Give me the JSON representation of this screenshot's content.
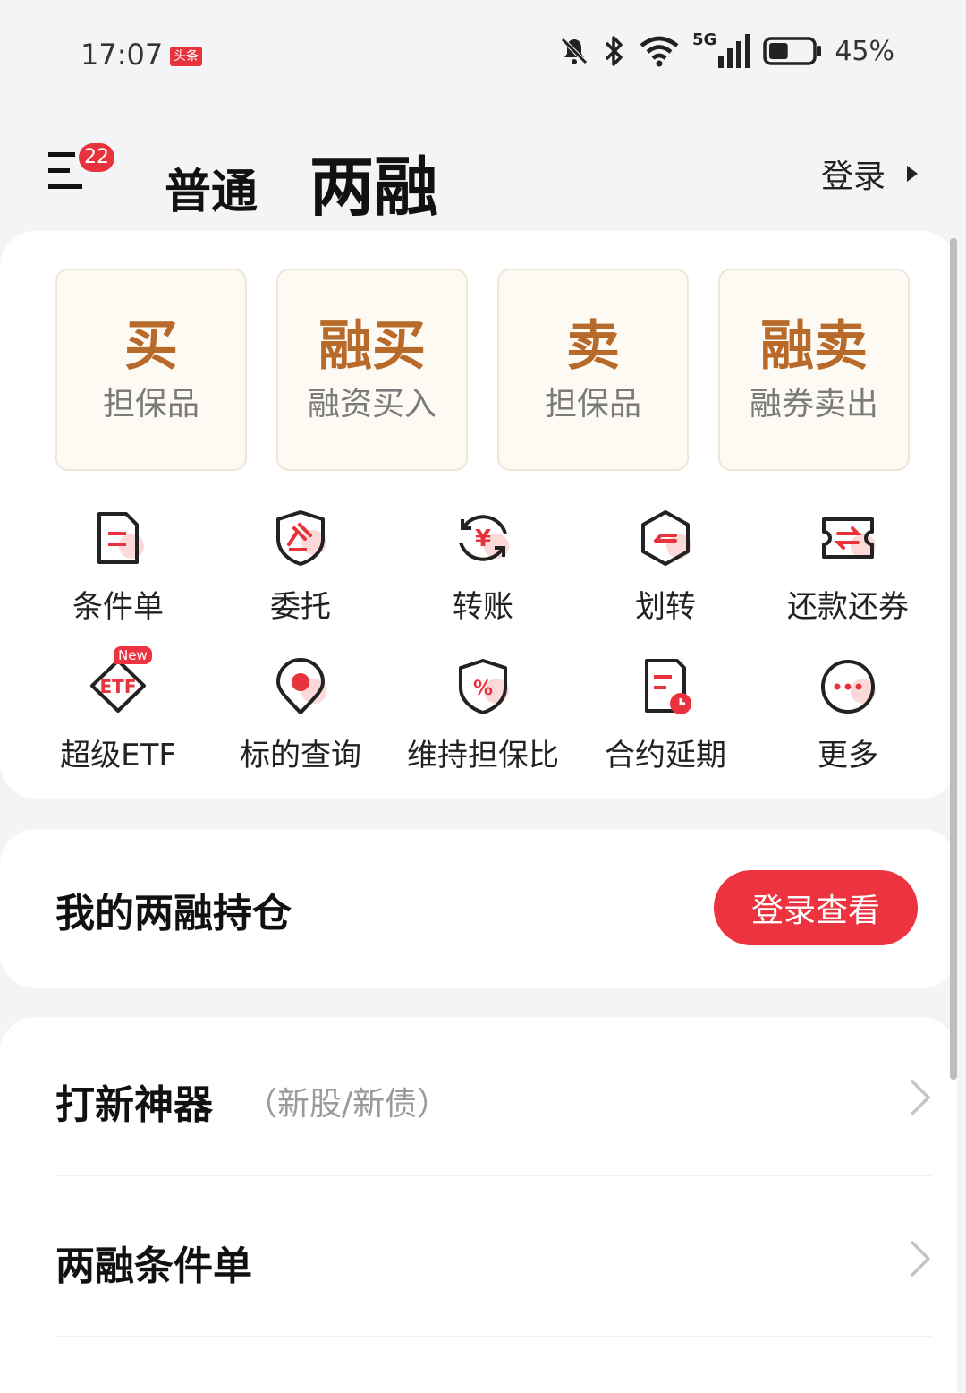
{
  "status": {
    "time": "17:07",
    "app_badge": "头条",
    "network": "5G",
    "battery": "45%",
    "battery_level": 0.45,
    "icons": [
      "mute-icon",
      "bluetooth-icon",
      "wifi-icon",
      "signal-icon",
      "battery-icon"
    ]
  },
  "header": {
    "menu_badge": "22",
    "tab_normal": "普通",
    "tab_margin": "两融",
    "login": "登录"
  },
  "trade_tiles": [
    {
      "main": "买",
      "sub": "担保品"
    },
    {
      "main": "融买",
      "sub": "融资买入"
    },
    {
      "main": "卖",
      "sub": "担保品"
    },
    {
      "main": "融卖",
      "sub": "融券卖出"
    }
  ],
  "grid": [
    {
      "label": "条件单",
      "icon": "condition-order-icon"
    },
    {
      "label": "委托",
      "icon": "entrust-icon"
    },
    {
      "label": "转账",
      "icon": "transfer-yuan-icon"
    },
    {
      "label": "划转",
      "icon": "transfer-icon"
    },
    {
      "label": "还款还券",
      "icon": "repay-icon"
    },
    {
      "label": "超级ETF",
      "icon": "etf-icon",
      "badge": "New",
      "icon_text": "ETF"
    },
    {
      "label": "标的查询",
      "icon": "location-icon"
    },
    {
      "label": "维持担保比",
      "icon": "ratio-icon",
      "icon_text": "%"
    },
    {
      "label": "合约延期",
      "icon": "contract-extend-icon"
    },
    {
      "label": "更多",
      "icon": "more-icon"
    }
  ],
  "holdings": {
    "title": "我的两融持仓",
    "button": "登录查看"
  },
  "list": [
    {
      "title": "打新神器",
      "sub": "（新股/新债）"
    },
    {
      "title": "两融条件单",
      "sub": ""
    }
  ],
  "colors": {
    "accent_red": "#ee3340",
    "tile_text": "#b86a2a",
    "tile_bg": "#fdfaf4"
  }
}
